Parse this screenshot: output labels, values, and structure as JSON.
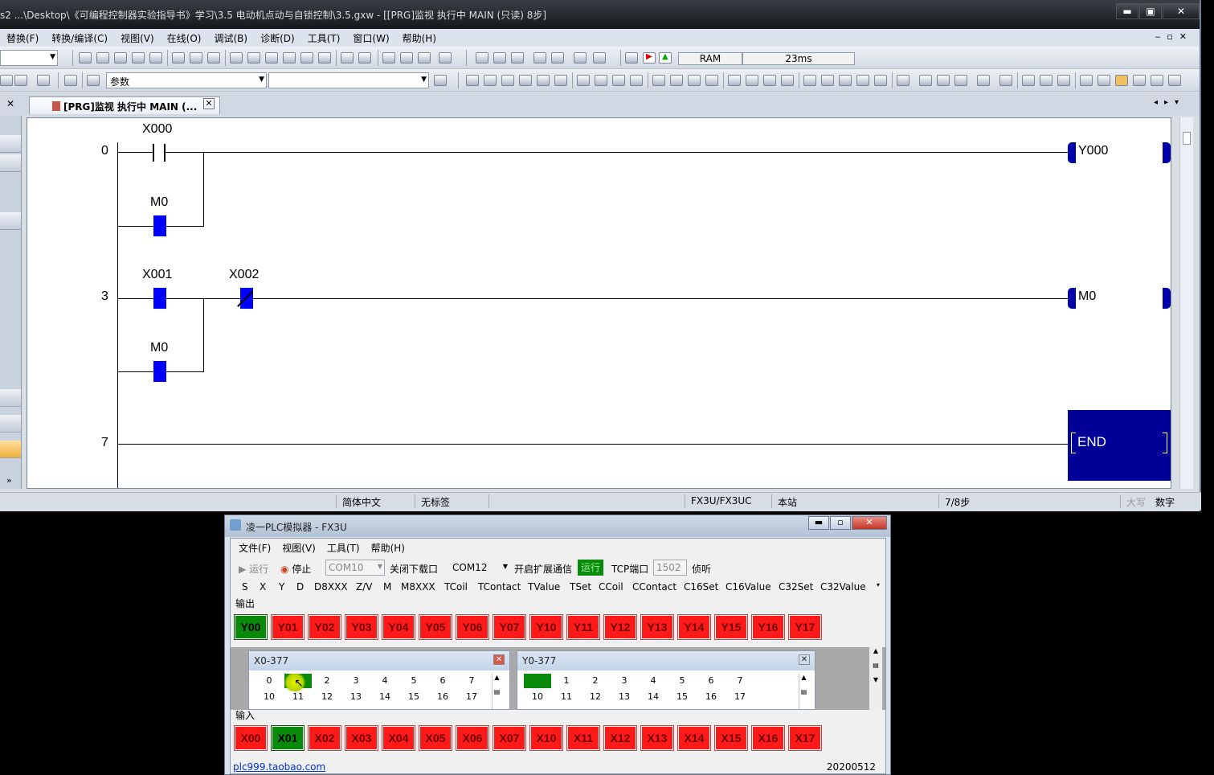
{
  "main_window": {
    "title": "s2 ...\\Desktop\\《可编程控制器实验指导书》学习\\3.5 电动机点动与自锁控制\\3.5.gxw - [[PRG]监视 执行中 MAIN (只读) 8步]",
    "menu": [
      "替换(F)",
      "转换/编译(C)",
      "视图(V)",
      "在线(O)",
      "调试(B)",
      "诊断(D)",
      "工具(T)",
      "窗口(W)",
      "帮助(H)"
    ],
    "toolbar": {
      "memory": "RAM",
      "scan_time": "23ms",
      "param_combo": "参数"
    },
    "tab": {
      "label": "[PRG]监视 执行中 MAIN (..."
    },
    "status_bar": {
      "language": "简体中文",
      "label": "无标签",
      "plc_type": "FX3U/FX3UC",
      "station": "本站",
      "steps": "7/8步",
      "caps": "大写",
      "num": "数字"
    }
  },
  "ladder": {
    "rungs": [
      {
        "step": "0",
        "contacts": [
          "X000",
          "M0"
        ],
        "coil": "Y000"
      },
      {
        "step": "3",
        "contacts": [
          "X001",
          "X002",
          "M0"
        ],
        "coil": "M0"
      },
      {
        "step": "7",
        "instruction": "END"
      }
    ]
  },
  "simulator": {
    "title": "凌一PLC模拟器 - FX3U",
    "menu": [
      "文件(F)",
      "视图(V)",
      "工具(T)",
      "帮助(H)"
    ],
    "toolbar": {
      "run": "运行",
      "stop": "停止",
      "com_disabled": "COM10",
      "close_download": "关闭下载口",
      "com_port": "COM12",
      "ext_comm": "开启扩展通信",
      "run_badge": "运行",
      "tcp_label": "TCP端口",
      "tcp_port": "1502",
      "listen": "侦听"
    },
    "registers": [
      "S",
      "X",
      "Y",
      "D",
      "D8XXX",
      "Z/V",
      "M",
      "M8XXX",
      "TCoil",
      "TContact",
      "TValue",
      "TSet",
      "CCoil",
      "CContact",
      "C16Set",
      "C16Value",
      "C32Set",
      "C32Value"
    ],
    "output_label": "输出",
    "outputs": [
      {
        "name": "Y00",
        "on": true
      },
      {
        "name": "Y01",
        "on": false
      },
      {
        "name": "Y02",
        "on": false
      },
      {
        "name": "Y03",
        "on": false
      },
      {
        "name": "Y04",
        "on": false
      },
      {
        "name": "Y05",
        "on": false
      },
      {
        "name": "Y06",
        "on": false
      },
      {
        "name": "Y07",
        "on": false
      },
      {
        "name": "Y10",
        "on": false
      },
      {
        "name": "Y11",
        "on": false
      },
      {
        "name": "Y12",
        "on": false
      },
      {
        "name": "Y13",
        "on": false
      },
      {
        "name": "Y14",
        "on": false
      },
      {
        "name": "Y15",
        "on": false
      },
      {
        "name": "Y16",
        "on": false
      },
      {
        "name": "Y17",
        "on": false
      }
    ],
    "monitor_x": {
      "title": "X0-377",
      "row1": [
        "0",
        "1",
        "2",
        "3",
        "4",
        "5",
        "6",
        "7"
      ],
      "row2": [
        "10",
        "11",
        "12",
        "13",
        "14",
        "15",
        "16",
        "17"
      ],
      "on_index": 1
    },
    "monitor_y": {
      "title": "Y0-377",
      "row1": [
        "0",
        "1",
        "2",
        "3",
        "4",
        "5",
        "6",
        "7"
      ],
      "row2": [
        "10",
        "11",
        "12",
        "13",
        "14",
        "15",
        "16",
        "17"
      ],
      "on_index": 0
    },
    "input_label": "输入",
    "inputs": [
      {
        "name": "X00",
        "on": false
      },
      {
        "name": "X01",
        "on": true
      },
      {
        "name": "X02",
        "on": false
      },
      {
        "name": "X03",
        "on": false
      },
      {
        "name": "X04",
        "on": false
      },
      {
        "name": "X05",
        "on": false
      },
      {
        "name": "X06",
        "on": false
      },
      {
        "name": "X07",
        "on": false
      },
      {
        "name": "X10",
        "on": false
      },
      {
        "name": "X11",
        "on": false
      },
      {
        "name": "X12",
        "on": false
      },
      {
        "name": "X13",
        "on": false
      },
      {
        "name": "X14",
        "on": false
      },
      {
        "name": "X15",
        "on": false
      },
      {
        "name": "X16",
        "on": false
      },
      {
        "name": "X17",
        "on": false
      }
    ],
    "footer": {
      "link": "plc999.taobao.com",
      "version": "20200512"
    }
  }
}
